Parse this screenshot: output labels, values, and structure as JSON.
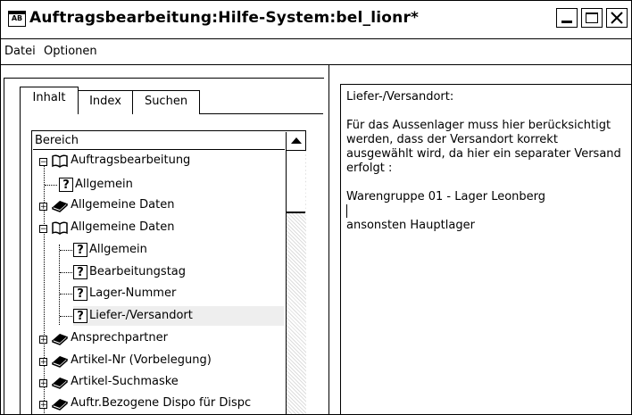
{
  "window": {
    "title": "Auftragsbearbeitung:Hilfe-System:bel_lionr*",
    "app_icon_text": "AB"
  },
  "menu": {
    "items": [
      "Datei",
      "Optionen"
    ]
  },
  "tabs": [
    {
      "label": "Inhalt",
      "active": true
    },
    {
      "label": "Index",
      "active": false
    },
    {
      "label": "Suchen",
      "active": false
    }
  ],
  "tree": {
    "header": "Bereich",
    "items": [
      {
        "label": "Auftragsbearbeitung",
        "icon": "open-book-icon",
        "expander": "−"
      },
      {
        "label": "Allgemein",
        "icon": "help-page-icon"
      },
      {
        "label": "Allgemeine Daten",
        "icon": "closed-book-icon",
        "expander": "+"
      },
      {
        "label": "Allgemeine Daten",
        "icon": "open-book-icon",
        "expander": "−"
      },
      {
        "label": "Allgemein",
        "icon": "help-page-icon"
      },
      {
        "label": "Bearbeitungstag",
        "icon": "help-page-icon"
      },
      {
        "label": "Lager-Nummer",
        "icon": "help-page-icon"
      },
      {
        "label": "Liefer-/Versandort",
        "icon": "help-page-icon",
        "selected": true
      },
      {
        "label": "Ansprechpartner",
        "icon": "closed-book-icon",
        "expander": "+"
      },
      {
        "label": "Artikel-Nr (Vorbelegung)",
        "icon": "closed-book-icon",
        "expander": "+"
      },
      {
        "label": "Artikel-Suchmaske",
        "icon": "closed-book-icon",
        "expander": "+"
      },
      {
        "label": "Auftr.Bezogene Dispo für Dispc",
        "icon": "closed-book-icon",
        "expander": "+"
      }
    ]
  },
  "content": {
    "heading": "Liefer-/Versandort:",
    "paragraph": "Für das Aussenlager muss hier berücksichtigt werden, dass der Versandort korrekt ausgewählt wird, da hier ein separater Versand erfolgt :",
    "line1": "Warengruppe 01 - Lager Leonberg",
    "line2": "ansonsten Hauptlager"
  }
}
